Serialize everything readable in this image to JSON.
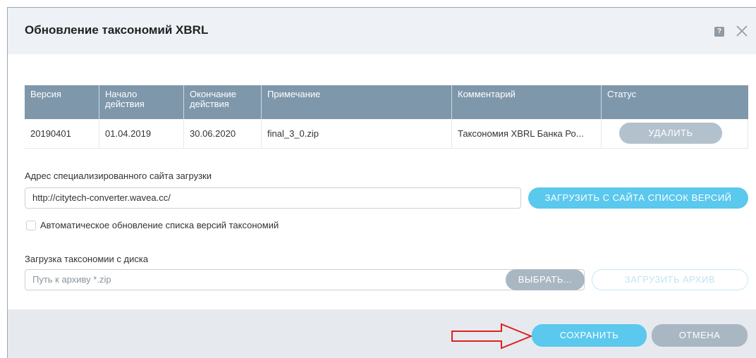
{
  "dialog": {
    "title": "Обновление таксономий XBRL",
    "help_glyph": "?",
    "icons": [
      "help-icon",
      "close-icon"
    ]
  },
  "table": {
    "headers": [
      "Версия",
      "Начало действия",
      "Окончание действия",
      "Примечание",
      "Комментарий",
      "Статус"
    ],
    "rows": [
      {
        "version": "20190401",
        "start": "01.04.2019",
        "end": "30.06.2020",
        "note": "final_3_0.zip",
        "comment": "Таксономия XBRL Банка Ро...",
        "status_button": "УДАЛИТЬ"
      }
    ]
  },
  "site": {
    "label": "Адрес специализированного сайта загрузки",
    "url": "http://citytech-converter.wavea.cc/",
    "load_button": "ЗАГРУЗИТЬ С САЙТА СПИСОК ВЕРСИЙ"
  },
  "auto_update": {
    "label": "Автоматическое обновление списка версий таксономий",
    "checked": false
  },
  "disk": {
    "label": "Загрузка таксономии с диска",
    "placeholder": "Путь к архиву *.zip",
    "choose_button": "ВЫБРАТЬ...",
    "load_archive_button": "ЗАГРУЗИТЬ АРХИВ"
  },
  "footer": {
    "save_button": "СОХРАНИТЬ",
    "cancel_button": "ОТМЕНА"
  },
  "colors": {
    "header_bg": "#eef2f6",
    "table_header": "#7e97ab",
    "accent": "#5bc8ee",
    "muted_button": "#a9b7c3",
    "annotation_arrow": "#e02020"
  }
}
